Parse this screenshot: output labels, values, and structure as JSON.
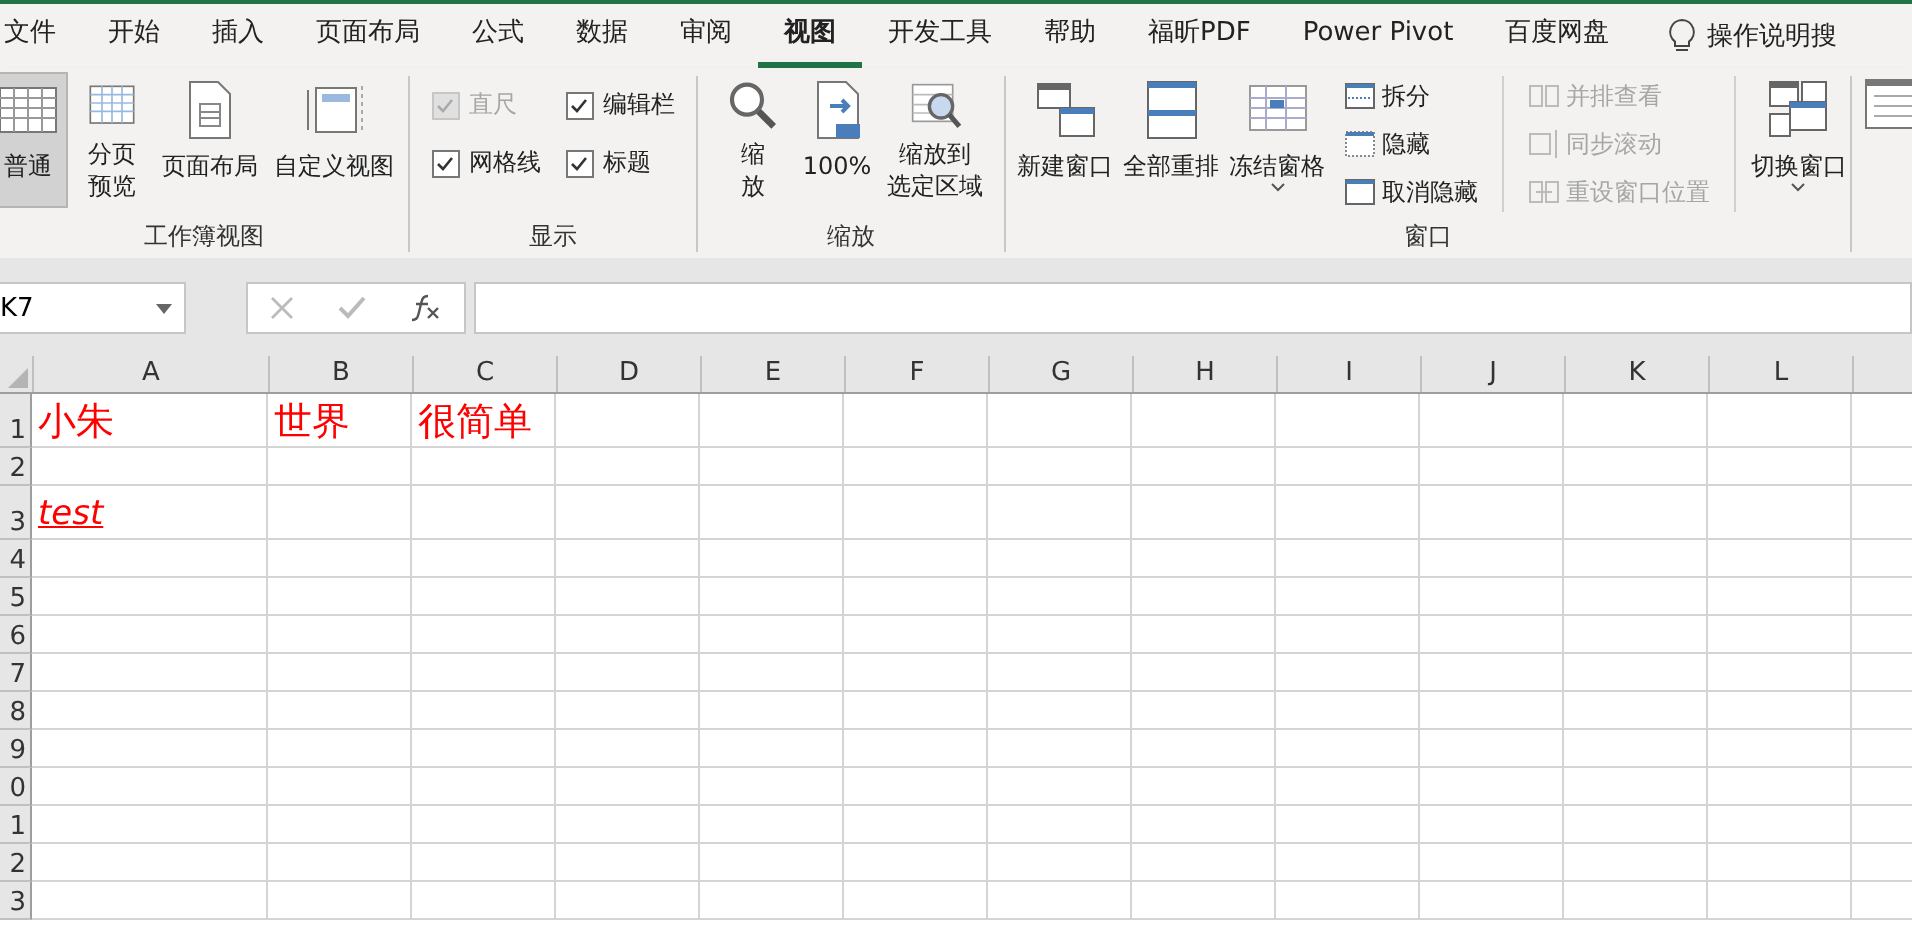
{
  "tabs": [
    {
      "label": "文件",
      "selected": false
    },
    {
      "label": "开始",
      "selected": false
    },
    {
      "label": "插入",
      "selected": false
    },
    {
      "label": "页面布局",
      "selected": false
    },
    {
      "label": "公式",
      "selected": false
    },
    {
      "label": "数据",
      "selected": false
    },
    {
      "label": "审阅",
      "selected": false
    },
    {
      "label": "视图",
      "selected": true
    },
    {
      "label": "开发工具",
      "selected": false
    },
    {
      "label": "帮助",
      "selected": false
    },
    {
      "label": "福昕PDF",
      "selected": false
    },
    {
      "label": "Power Pivot",
      "selected": false
    },
    {
      "label": "百度网盘",
      "selected": false
    }
  ],
  "tell_me": {
    "label": "操作说明搜"
  },
  "ribbon": [
    {
      "kind": "buttons",
      "label": "工作簿视图",
      "items": [
        {
          "lines": [
            "普通"
          ],
          "selected": true
        },
        {
          "lines": [
            "分页",
            "预览"
          ],
          "selected": false
        },
        {
          "lines": [
            "页面布局"
          ],
          "selected": false
        },
        {
          "lines": [
            "自定义视图"
          ],
          "selected": false
        }
      ]
    },
    {
      "kind": "checks",
      "label": "显示",
      "items": [
        {
          "label": "直尺",
          "checked": true,
          "disabled": true
        },
        {
          "label": "编辑栏",
          "checked": true,
          "disabled": false
        },
        {
          "label": "网格线",
          "checked": true,
          "disabled": false
        },
        {
          "label": "标题",
          "checked": true,
          "disabled": false
        }
      ]
    },
    {
      "kind": "buttons",
      "label": "缩放",
      "items": [
        {
          "lines": [
            "缩",
            "放"
          ],
          "selected": false
        },
        {
          "lines": [
            "100%"
          ],
          "selected": false
        },
        {
          "lines": [
            "缩放到",
            "选定区域"
          ],
          "selected": false
        }
      ]
    },
    {
      "kind": "window",
      "label": "窗口",
      "big": [
        {
          "lines": [
            "新建窗口"
          ],
          "selected": false,
          "dropdown": false
        },
        {
          "lines": [
            "全部重排"
          ],
          "selected": false,
          "dropdown": false
        },
        {
          "lines": [
            "冻结窗格"
          ],
          "selected": false,
          "dropdown": true
        }
      ],
      "small": [
        {
          "label": "拆分",
          "disabled": false
        },
        {
          "label": "隐藏",
          "disabled": false
        },
        {
          "label": "取消隐藏",
          "disabled": false
        }
      ],
      "sync": [
        {
          "label": "并排查看",
          "disabled": true
        },
        {
          "label": "同步滚动",
          "disabled": true
        },
        {
          "label": "重设窗口位置",
          "disabled": true
        }
      ],
      "switch": [
        {
          "lines": [
            "切换窗口"
          ],
          "selected": false,
          "dropdown": true
        }
      ]
    }
  ],
  "formula_bar": {
    "name_box": "K7"
  },
  "sheet": {
    "columns": [
      "A",
      "B",
      "C",
      "D",
      "E",
      "F",
      "G",
      "H",
      "I",
      "J",
      "K",
      "L"
    ],
    "rows": [
      {
        "header": "1",
        "cells": [
          {
            "text": "小朱",
            "italic": false,
            "underline": false
          },
          {
            "text": "世界",
            "italic": false,
            "underline": false
          },
          {
            "text": "很简单",
            "italic": false,
            "underline": false
          }
        ]
      },
      {
        "header": "2"
      },
      {
        "header": "3",
        "cells": [
          {
            "text": "test",
            "italic": true,
            "underline": true
          }
        ]
      },
      {
        "header": "4"
      },
      {
        "header": "5"
      },
      {
        "header": "6"
      },
      {
        "header": "7"
      },
      {
        "header": "8"
      },
      {
        "header": "9"
      },
      {
        "header": "0"
      },
      {
        "header": "1"
      },
      {
        "header": "2"
      },
      {
        "header": "3"
      }
    ]
  }
}
